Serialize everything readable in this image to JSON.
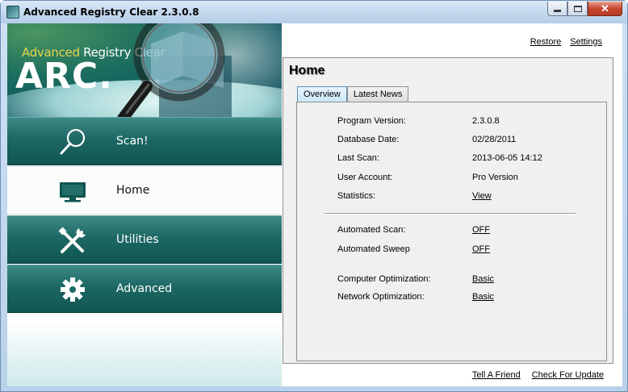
{
  "window": {
    "title": "Advanced Registry Clear  2.3.0.8",
    "buttons": {
      "close": "✕"
    }
  },
  "banner": {
    "brand_accent": "Advanced",
    "brand_rest": " Registry Clear",
    "abbr": "ARC."
  },
  "nav": {
    "items": [
      {
        "label": "Scan!",
        "icon": "magnifier-icon"
      },
      {
        "label": "Home",
        "icon": "monitor-icon"
      },
      {
        "label": "Utilities",
        "icon": "tools-icon"
      },
      {
        "label": "Advanced",
        "icon": "gear-icon"
      }
    ]
  },
  "toplinks": {
    "restore": "Restore",
    "settings": "Settings"
  },
  "home": {
    "title": "Home",
    "tabs": [
      {
        "label": "Overview"
      },
      {
        "label": "Latest News"
      }
    ],
    "info": [
      {
        "key": "Program Version:",
        "value": "2.3.0.8"
      },
      {
        "key": "Database Date:",
        "value": "02/28/2011"
      },
      {
        "key": "Last Scan:",
        "value": "2013-06-05 14:12"
      },
      {
        "key": "User Account:",
        "value": "Pro Version"
      },
      {
        "key": "Statistics:",
        "value": "View"
      }
    ],
    "settings": [
      {
        "key": "Automated Scan:",
        "value": "OFF"
      },
      {
        "key": "Automated Sweep",
        "value": "OFF"
      },
      {
        "key": "Computer Optimization:",
        "value": "Basic"
      },
      {
        "key": "Network Optimization:",
        "value": "Basic"
      }
    ]
  },
  "bottomlinks": {
    "tell_friend": "Tell A Friend",
    "check_update": "Check For Update"
  },
  "colors": {
    "nav_dark": "#1d6864",
    "accent_yellow": "#e8d44b",
    "link": "#000000"
  }
}
